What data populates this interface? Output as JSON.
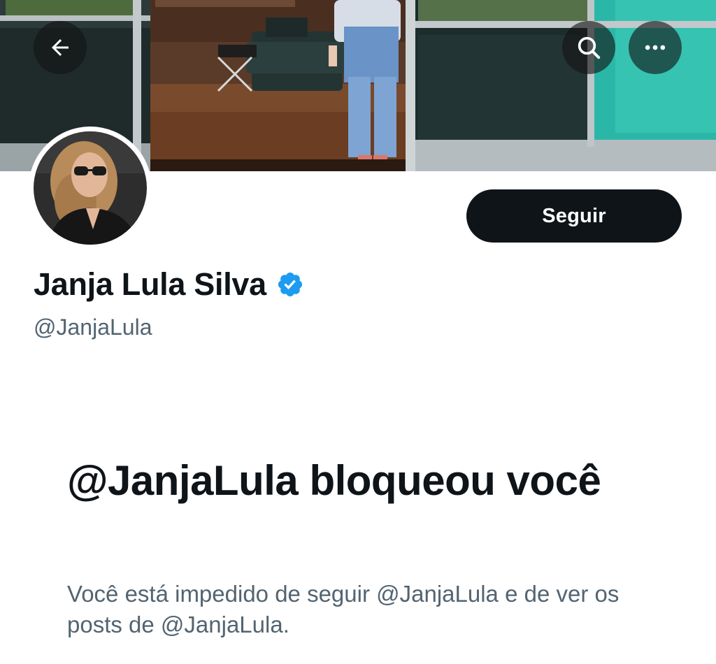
{
  "header": {
    "back_icon": "arrow-left-icon",
    "search_icon": "search-icon",
    "more_icon": "more-horizontal-icon"
  },
  "profile": {
    "display_name": "Janja Lula Silva",
    "verified_icon": "verified-badge-icon",
    "verified_color": "#1d9bf0",
    "handle": "@JanjaLula",
    "follow_label": "Seguir"
  },
  "blocked_notice": {
    "title": "@JanjaLula bloqueou você",
    "description": "Você está impedido de seguir @JanjaLula e de ver os posts de @JanjaLula."
  },
  "colors": {
    "primary_text": "#0f1419",
    "secondary_text": "#536471",
    "button_bg": "#0f1419",
    "button_text": "#ffffff"
  }
}
